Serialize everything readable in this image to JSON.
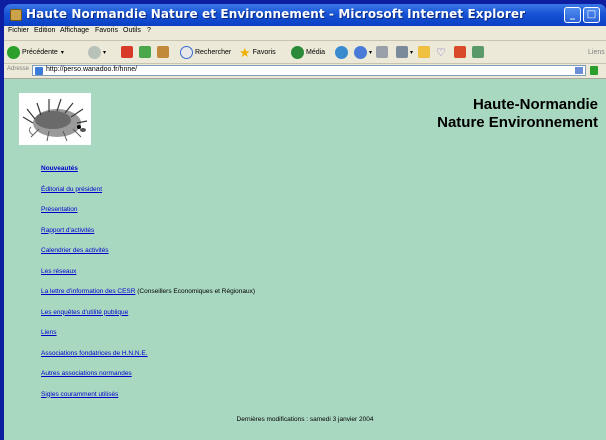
{
  "window": {
    "title": "Haute Normandie Nature et Environnement - Microsoft Internet Explorer",
    "min_glyph": "_",
    "max_glyph": "□"
  },
  "menu": [
    "Fichier",
    "Edition",
    "Affichage",
    "Favoris",
    "Outils",
    "?"
  ],
  "toolbar": {
    "back_label": "Précédente",
    "search_label": "Rechercher",
    "favorites_label": "Favoris",
    "media_label": "Média",
    "links_label": "Liens"
  },
  "address": {
    "label": "Adresse",
    "url": "http://perso.wanadoo.fr/hnne/"
  },
  "site": {
    "title_line1": "Haute-Normandie",
    "title_line2": "Nature Environnement"
  },
  "nav": [
    {
      "label": "Nouveautés",
      "bold": true,
      "suffix": ""
    },
    {
      "label": "Éditorial du président",
      "bold": false,
      "suffix": ""
    },
    {
      "label": "Présentation",
      "bold": false,
      "suffix": ""
    },
    {
      "label": "Rapport d'activités",
      "bold": false,
      "suffix": ""
    },
    {
      "label": "Calendrier des activités",
      "bold": false,
      "suffix": ""
    },
    {
      "label": "Les réseaux",
      "bold": false,
      "suffix": ""
    },
    {
      "label": "La lettre d'information des CESR",
      "bold": false,
      "suffix": " (Conseillers Economiques et Régionaux)"
    },
    {
      "label": "Les enquêtes d'utilité publique",
      "bold": false,
      "suffix": ""
    },
    {
      "label": "Liens",
      "bold": false,
      "suffix": ""
    },
    {
      "label": "Associations fondatrices de H.N.N.E.",
      "bold": false,
      "suffix": ""
    },
    {
      "label": "Autres associations normandes",
      "bold": false,
      "suffix": ""
    },
    {
      "label": "Sigles couramment utilisés",
      "bold": false,
      "suffix": ""
    }
  ],
  "footer": {
    "last_modified": "Dernières modifications : samedi 3 janvier 2004"
  },
  "colors": {
    "page_background": "#a9d8c0",
    "link": "#0000cc",
    "outer_background": "#0e1ea0"
  }
}
